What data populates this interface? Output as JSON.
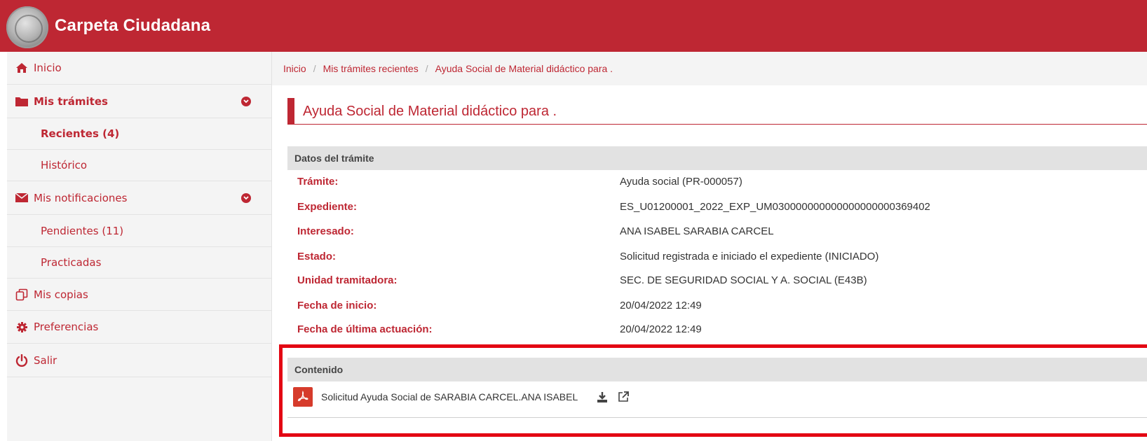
{
  "app": {
    "title": "Carpeta Ciudadana"
  },
  "sidebar": {
    "items": [
      {
        "label": "Inicio",
        "icon": "home-icon"
      },
      {
        "label": "Mis trámites",
        "icon": "folder-icon",
        "expanded": true
      },
      {
        "label": "Recientes (4)",
        "active": true
      },
      {
        "label": "Histórico"
      },
      {
        "label": "Mis notificaciones",
        "icon": "envelope-icon",
        "expanded": true
      },
      {
        "label": "Pendientes (11)"
      },
      {
        "label": "Practicadas"
      },
      {
        "label": "Mis copias",
        "icon": "copy-icon"
      },
      {
        "label": "Preferencias",
        "icon": "gear-icon"
      },
      {
        "label": "Salir",
        "icon": "power-icon"
      }
    ]
  },
  "breadcrumb": [
    "Inicio",
    "Mis trámites recientes",
    "Ayuda Social de Material didáctico para ."
  ],
  "page": {
    "title": "Ayuda Social de Material didáctico para ."
  },
  "datos": {
    "heading": "Datos del trámite",
    "rows": [
      {
        "label": "Trámite:",
        "value": "Ayuda social (PR-000057)"
      },
      {
        "label": "Expediente:",
        "value": "ES_U01200001_2022_EXP_UM030000000000000000000369402"
      },
      {
        "label": "Interesado:",
        "value": "ANA ISABEL SARABIA CARCEL"
      },
      {
        "label": "Estado:",
        "value": "Solicitud registrada e iniciado el expediente (INICIADO)"
      },
      {
        "label": "Unidad tramitadora:",
        "value": "SEC. DE SEGURIDAD SOCIAL Y A. SOCIAL (E43B)"
      },
      {
        "label": "Fecha de inicio:",
        "value": "20/04/2022 12:49"
      },
      {
        "label": "Fecha de última actuación:",
        "value": "20/04/2022 12:49"
      }
    ]
  },
  "contenido": {
    "heading": "Contenido",
    "document": {
      "label": "Solicitud Ayuda Social de SARABIA CARCEL.ANA ISABEL",
      "icon": "pdf-icon"
    }
  },
  "colors": {
    "brand": "#be2733",
    "highlight": "#e30613"
  }
}
